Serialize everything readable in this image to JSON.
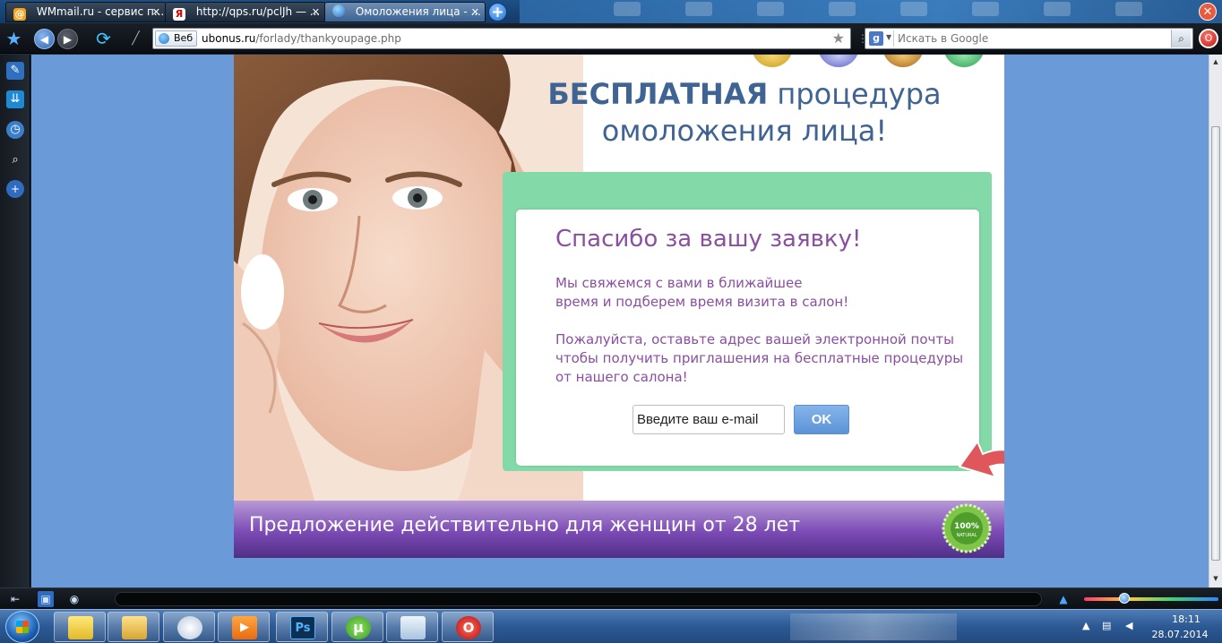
{
  "tabs": [
    {
      "title": "WMmail.ru - сервис п...",
      "icon": "at-sign-icon",
      "active": false
    },
    {
      "title": "http://qps.ru/pclJh — ...",
      "icon": "yandex-icon",
      "active": false
    },
    {
      "title": "Омоложения лица - ...",
      "icon": "globe-icon",
      "active": true
    }
  ],
  "new_tab_glyph": "+",
  "nav": {
    "web_badge": "Веб",
    "url_host": "ubonus.ru",
    "url_path": "/forlady/thankyoupage.php",
    "search_placeholder": "Искать в Google",
    "search_engine_glyph": "g"
  },
  "page": {
    "headline_bold": "БЕСПЛАТНАЯ",
    "headline_rest_line1": " процедура",
    "headline_line2": "омоложения лица!",
    "thanks_title": "Спасибо за вашу заявку!",
    "paragraph1_line1": "Мы свяжемся с вами в ближайшее",
    "paragraph1_line2": "время и подберем время визита в салон!",
    "paragraph2_line1": "Пожалуйста, оставьте адрес вашей электронной почты",
    "paragraph2_line2": "чтобы получить приглашения на бесплатные процедуры",
    "paragraph2_line3": "от нашего салона!",
    "email_placeholder": "Введите ваш e-mail",
    "ok_label": "OK",
    "offer_text": "Предложение действительно для женщин от 28 лет",
    "seal_text_top": "100%",
    "seal_text_bottom": "NATURAL"
  },
  "taskbar": {
    "apps": [
      {
        "name": "explorer-sticky-icon",
        "glyph": ""
      },
      {
        "name": "folder-icon",
        "glyph": ""
      },
      {
        "name": "paint-icon",
        "glyph": ""
      },
      {
        "name": "media-player-icon",
        "glyph": "▶"
      },
      {
        "name": "photoshop-icon",
        "glyph": "Ps"
      },
      {
        "name": "utorrent-icon",
        "glyph": "µ"
      },
      {
        "name": "notepad-icon",
        "glyph": ""
      },
      {
        "name": "opera-icon",
        "glyph": "O"
      }
    ],
    "clock_time": "18:11",
    "clock_date": "28.07.2014"
  },
  "colors": {
    "headline": "#3f6392",
    "thanks_text": "#8a4fa0",
    "green_frame": "#84d9a8",
    "offer_bar": "#7c4ab5",
    "page_background": "#6a9ad8"
  }
}
